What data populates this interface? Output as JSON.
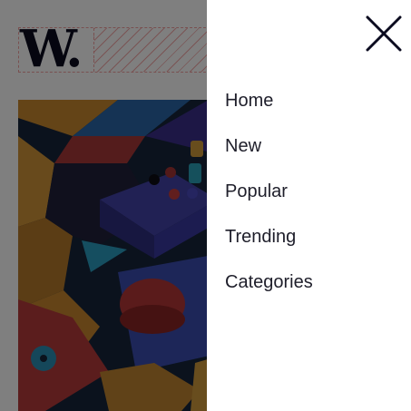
{
  "brand": {
    "logo_text": "W."
  },
  "menu": {
    "items": [
      {
        "label": "Home"
      },
      {
        "label": "New"
      },
      {
        "label": "Popular"
      },
      {
        "label": "Trending"
      },
      {
        "label": "Categories"
      }
    ]
  },
  "icons": {
    "close": "close-icon"
  },
  "colors": {
    "text_dark": "#1e1e2a",
    "logo": "#0b0b1f",
    "overlay": "rgba(0,0,0,0.5)",
    "guide": "#f3a1a1"
  }
}
